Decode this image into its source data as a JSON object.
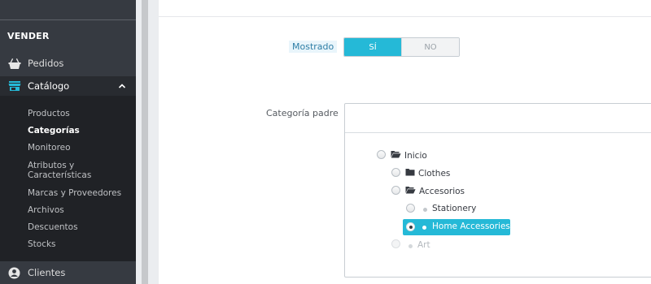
{
  "sidebar": {
    "section_title": "VENDER",
    "items": [
      {
        "label": "Pedidos",
        "icon": "basket-icon"
      },
      {
        "label": "Catálogo",
        "icon": "store-icon",
        "active": true
      },
      {
        "label": "Clientes",
        "icon": "user-circle-icon"
      }
    ],
    "submenu": [
      "Productos",
      "Categorías",
      "Monitoreo",
      "Atributos y Características",
      "Marcas y Proveedores",
      "Archivos",
      "Descuentos",
      "Stocks"
    ],
    "current_submenu": "Categorías"
  },
  "form": {
    "displayed_label": "Mostrado",
    "switch_yes": "SÍ",
    "switch_no": "NO",
    "switch_value": "SÍ",
    "parent_label": "Categoría padre"
  },
  "tree": {
    "root": "Inicio",
    "children": [
      "Clothes",
      "Accesorios"
    ],
    "accessories_children": [
      "Stationery",
      "Home Accessories"
    ],
    "disabled_item": "Art",
    "selected": "Home Accessories"
  },
  "colors": {
    "accent": "#25b9d7",
    "sidebar_bg": "#363a41",
    "submenu_bg": "#202226"
  }
}
